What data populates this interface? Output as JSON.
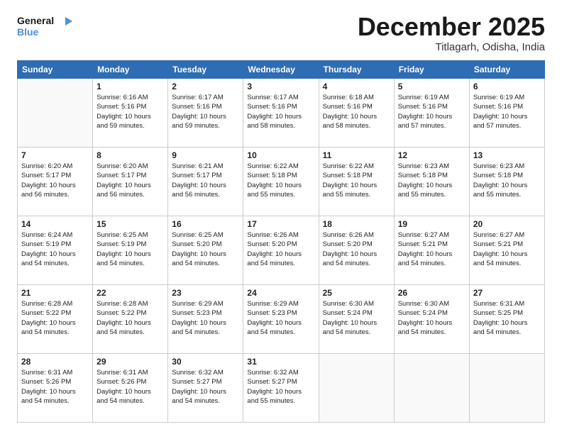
{
  "logo": {
    "line1": "General",
    "line2": "Blue"
  },
  "title": "December 2025",
  "location": "Titlagarh, Odisha, India",
  "headers": [
    "Sunday",
    "Monday",
    "Tuesday",
    "Wednesday",
    "Thursday",
    "Friday",
    "Saturday"
  ],
  "weeks": [
    [
      {
        "day": "",
        "info": ""
      },
      {
        "day": "1",
        "info": "Sunrise: 6:16 AM\nSunset: 5:16 PM\nDaylight: 10 hours\nand 59 minutes."
      },
      {
        "day": "2",
        "info": "Sunrise: 6:17 AM\nSunset: 5:16 PM\nDaylight: 10 hours\nand 59 minutes."
      },
      {
        "day": "3",
        "info": "Sunrise: 6:17 AM\nSunset: 5:16 PM\nDaylight: 10 hours\nand 58 minutes."
      },
      {
        "day": "4",
        "info": "Sunrise: 6:18 AM\nSunset: 5:16 PM\nDaylight: 10 hours\nand 58 minutes."
      },
      {
        "day": "5",
        "info": "Sunrise: 6:19 AM\nSunset: 5:16 PM\nDaylight: 10 hours\nand 57 minutes."
      },
      {
        "day": "6",
        "info": "Sunrise: 6:19 AM\nSunset: 5:16 PM\nDaylight: 10 hours\nand 57 minutes."
      }
    ],
    [
      {
        "day": "7",
        "info": "Sunrise: 6:20 AM\nSunset: 5:17 PM\nDaylight: 10 hours\nand 56 minutes."
      },
      {
        "day": "8",
        "info": "Sunrise: 6:20 AM\nSunset: 5:17 PM\nDaylight: 10 hours\nand 56 minutes."
      },
      {
        "day": "9",
        "info": "Sunrise: 6:21 AM\nSunset: 5:17 PM\nDaylight: 10 hours\nand 56 minutes."
      },
      {
        "day": "10",
        "info": "Sunrise: 6:22 AM\nSunset: 5:18 PM\nDaylight: 10 hours\nand 55 minutes."
      },
      {
        "day": "11",
        "info": "Sunrise: 6:22 AM\nSunset: 5:18 PM\nDaylight: 10 hours\nand 55 minutes."
      },
      {
        "day": "12",
        "info": "Sunrise: 6:23 AM\nSunset: 5:18 PM\nDaylight: 10 hours\nand 55 minutes."
      },
      {
        "day": "13",
        "info": "Sunrise: 6:23 AM\nSunset: 5:18 PM\nDaylight: 10 hours\nand 55 minutes."
      }
    ],
    [
      {
        "day": "14",
        "info": "Sunrise: 6:24 AM\nSunset: 5:19 PM\nDaylight: 10 hours\nand 54 minutes."
      },
      {
        "day": "15",
        "info": "Sunrise: 6:25 AM\nSunset: 5:19 PM\nDaylight: 10 hours\nand 54 minutes."
      },
      {
        "day": "16",
        "info": "Sunrise: 6:25 AM\nSunset: 5:20 PM\nDaylight: 10 hours\nand 54 minutes."
      },
      {
        "day": "17",
        "info": "Sunrise: 6:26 AM\nSunset: 5:20 PM\nDaylight: 10 hours\nand 54 minutes."
      },
      {
        "day": "18",
        "info": "Sunrise: 6:26 AM\nSunset: 5:20 PM\nDaylight: 10 hours\nand 54 minutes."
      },
      {
        "day": "19",
        "info": "Sunrise: 6:27 AM\nSunset: 5:21 PM\nDaylight: 10 hours\nand 54 minutes."
      },
      {
        "day": "20",
        "info": "Sunrise: 6:27 AM\nSunset: 5:21 PM\nDaylight: 10 hours\nand 54 minutes."
      }
    ],
    [
      {
        "day": "21",
        "info": "Sunrise: 6:28 AM\nSunset: 5:22 PM\nDaylight: 10 hours\nand 54 minutes."
      },
      {
        "day": "22",
        "info": "Sunrise: 6:28 AM\nSunset: 5:22 PM\nDaylight: 10 hours\nand 54 minutes."
      },
      {
        "day": "23",
        "info": "Sunrise: 6:29 AM\nSunset: 5:23 PM\nDaylight: 10 hours\nand 54 minutes."
      },
      {
        "day": "24",
        "info": "Sunrise: 6:29 AM\nSunset: 5:23 PM\nDaylight: 10 hours\nand 54 minutes."
      },
      {
        "day": "25",
        "info": "Sunrise: 6:30 AM\nSunset: 5:24 PM\nDaylight: 10 hours\nand 54 minutes."
      },
      {
        "day": "26",
        "info": "Sunrise: 6:30 AM\nSunset: 5:24 PM\nDaylight: 10 hours\nand 54 minutes."
      },
      {
        "day": "27",
        "info": "Sunrise: 6:31 AM\nSunset: 5:25 PM\nDaylight: 10 hours\nand 54 minutes."
      }
    ],
    [
      {
        "day": "28",
        "info": "Sunrise: 6:31 AM\nSunset: 5:26 PM\nDaylight: 10 hours\nand 54 minutes."
      },
      {
        "day": "29",
        "info": "Sunrise: 6:31 AM\nSunset: 5:26 PM\nDaylight: 10 hours\nand 54 minutes."
      },
      {
        "day": "30",
        "info": "Sunrise: 6:32 AM\nSunset: 5:27 PM\nDaylight: 10 hours\nand 54 minutes."
      },
      {
        "day": "31",
        "info": "Sunrise: 6:32 AM\nSunset: 5:27 PM\nDaylight: 10 hours\nand 55 minutes."
      },
      {
        "day": "",
        "info": ""
      },
      {
        "day": "",
        "info": ""
      },
      {
        "day": "",
        "info": ""
      }
    ]
  ]
}
